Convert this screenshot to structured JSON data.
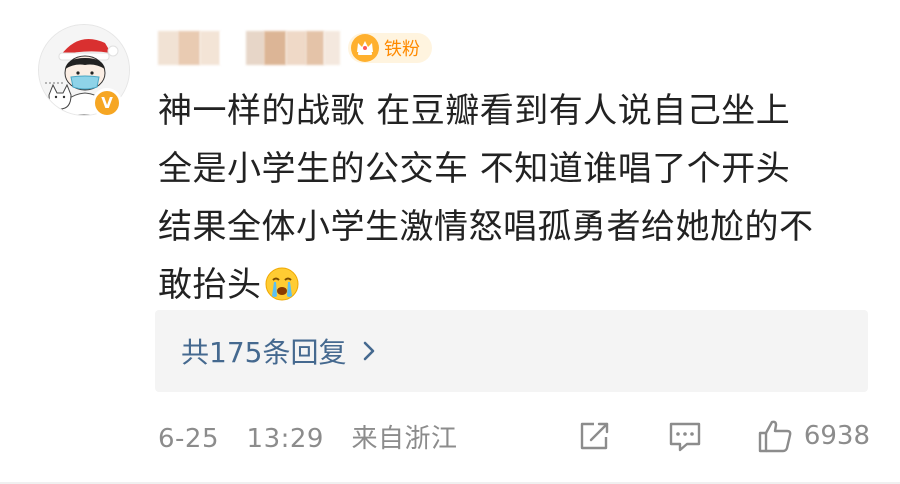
{
  "comment": {
    "user": {
      "badge_label": "铁粉",
      "verified_mark": "V",
      "avatar_icon": "cartoon-avatar-icon"
    },
    "text_lines": [
      "神一样的战歌 在豆瓣看到有人说自己坐上",
      "全是小学生的公交车 不知道谁唱了个开头",
      "结果全体小学生激情怒唱孤勇者给她尬的不",
      "敢抬头"
    ],
    "emoji": "crying-face-emoji",
    "replies_label": "共175条回复",
    "date": "6-25",
    "time": "13:29",
    "location": "来自浙江",
    "like_count": "6938"
  },
  "colors": {
    "text": "#222222",
    "meta": "#8c8c8c",
    "link": "#45698f",
    "badge": "#ff8a00",
    "verified": "#f6a623",
    "reply_bg": "#f4f4f4"
  }
}
